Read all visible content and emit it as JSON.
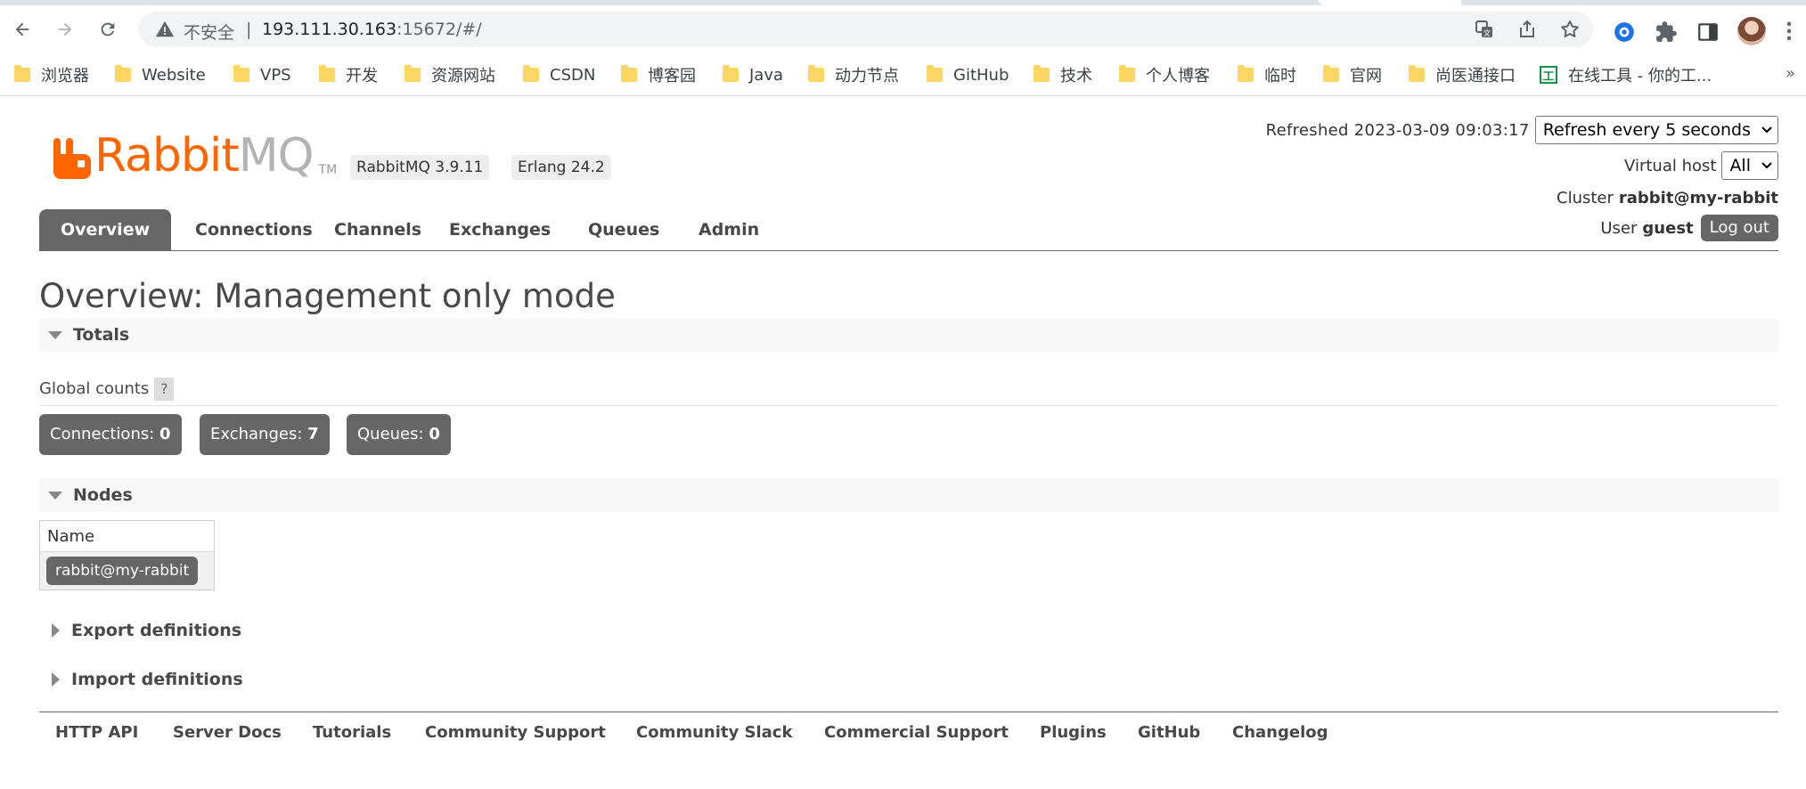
{
  "browser": {
    "security_label": "不安全",
    "url_host": "193.111.30.163",
    "url_rest": ":15672/#/",
    "bookmarks": [
      {
        "label": "浏览器",
        "icon": "folder-icon"
      },
      {
        "label": "Website",
        "icon": "folder-icon"
      },
      {
        "label": "VPS",
        "icon": "folder-icon"
      },
      {
        "label": "开发",
        "icon": "folder-icon"
      },
      {
        "label": "资源网站",
        "icon": "folder-icon"
      },
      {
        "label": "CSDN",
        "icon": "folder-icon"
      },
      {
        "label": "博客园",
        "icon": "folder-icon"
      },
      {
        "label": "Java",
        "icon": "folder-icon"
      },
      {
        "label": "动力节点",
        "icon": "folder-icon"
      },
      {
        "label": "GitHub",
        "icon": "folder-icon"
      },
      {
        "label": "技术",
        "icon": "folder-icon"
      },
      {
        "label": "个人博客",
        "icon": "folder-icon"
      },
      {
        "label": "临时",
        "icon": "folder-icon"
      },
      {
        "label": "官网",
        "icon": "folder-icon"
      },
      {
        "label": "尚医通接口",
        "icon": "folder-icon"
      },
      {
        "label": "在线工具 - 你的工...",
        "icon": "site-icon",
        "icon_glyph": "工"
      }
    ],
    "more_label": "»"
  },
  "header": {
    "logo_rabbit": "Rabbit",
    "logo_mq": "MQ",
    "logo_tm": "TM",
    "rabbitmq_version": "RabbitMQ 3.9.11",
    "erlang_version": "Erlang 24.2",
    "refreshed_label": "Refreshed 2023-03-09 09:03:17",
    "refresh_select_value": "Refresh every 5 seconds",
    "vhost_label": "Virtual host",
    "vhost_select_value": "All",
    "cluster_label": "Cluster",
    "cluster_name": "rabbit@my-rabbit",
    "user_label": "User",
    "user_name": "guest",
    "logout_label": "Log out"
  },
  "tabs": [
    {
      "label": "Overview",
      "active": true
    },
    {
      "label": "Connections",
      "active": false
    },
    {
      "label": "Channels",
      "active": false
    },
    {
      "label": "Exchanges",
      "active": false
    },
    {
      "label": "Queues",
      "active": false
    },
    {
      "label": "Admin",
      "active": false
    }
  ],
  "main": {
    "title": "Overview: Management only mode",
    "totals": {
      "heading": "Totals",
      "global_counts_label": "Global counts",
      "help_label": "?",
      "counts": [
        {
          "label": "Connections:",
          "value": "0"
        },
        {
          "label": "Exchanges:",
          "value": "7"
        },
        {
          "label": "Queues:",
          "value": "0"
        }
      ]
    },
    "nodes": {
      "heading": "Nodes",
      "column_name": "Name",
      "rows": [
        "rabbit@my-rabbit"
      ]
    },
    "export_heading": "Export definitions",
    "import_heading": "Import definitions"
  },
  "footer": {
    "links": [
      "HTTP API",
      "Server Docs",
      "Tutorials",
      "Community Support",
      "Community Slack",
      "Commercial Support",
      "Plugins",
      "GitHub",
      "Changelog"
    ]
  },
  "colors": {
    "brand_orange": "#ff6600",
    "tab_active": "#666666",
    "pill_bg": "#666666"
  }
}
